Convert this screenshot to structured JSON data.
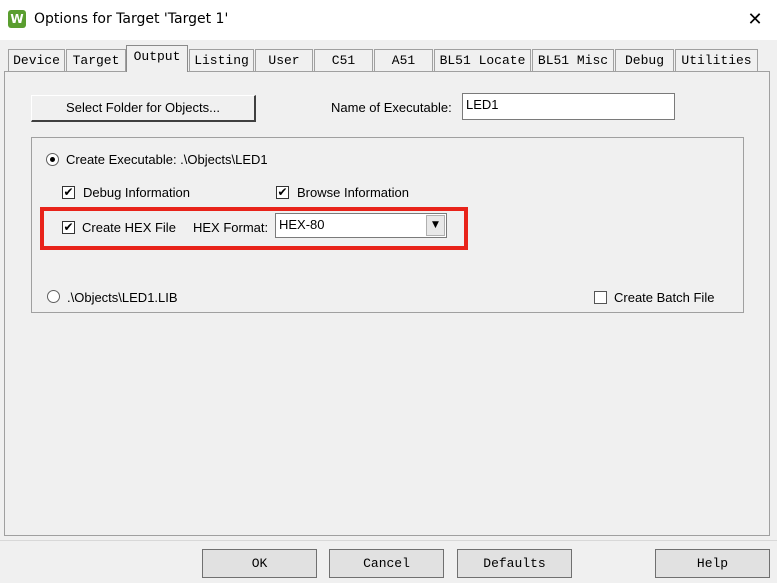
{
  "window": {
    "app_icon_glyph": "W",
    "title": "Options for Target 'Target 1'",
    "close_glyph": "✕"
  },
  "tabs": [
    {
      "label": "Device",
      "active": false
    },
    {
      "label": "Target",
      "active": false
    },
    {
      "label": "Output",
      "active": true
    },
    {
      "label": "Listing",
      "active": false
    },
    {
      "label": "User",
      "active": false
    },
    {
      "label": "C51",
      "active": false
    },
    {
      "label": "A51",
      "active": false
    },
    {
      "label": "BL51 Locate",
      "active": false
    },
    {
      "label": "BL51 Misc",
      "active": false
    },
    {
      "label": "Debug",
      "active": false
    },
    {
      "label": "Utilities",
      "active": false
    }
  ],
  "output": {
    "select_folder_label": "Select Folder for Objects...",
    "name_label": "Name of Executable:",
    "name_value": "LED1",
    "create_executable": {
      "label": "Create Executable:  .\\Objects\\LED1",
      "selected": true
    },
    "debug_info": {
      "label": "Debug Information",
      "checked": true
    },
    "browse_info": {
      "label": "Browse Information",
      "checked": true
    },
    "create_hex": {
      "label": "Create HEX File",
      "checked": true
    },
    "hex_format_label": "HEX Format:",
    "hex_format_value": "HEX-80",
    "create_library": {
      "label": ".\\Objects\\LED1.LIB",
      "selected": false
    },
    "create_batch": {
      "label": "Create Batch File",
      "checked": false
    },
    "highlight_color": "#e8231a"
  },
  "buttons": {
    "ok": "OK",
    "cancel": "Cancel",
    "defaults": "Defaults",
    "help": "Help"
  },
  "icons": {
    "check_glyph": "✔",
    "dropdown_glyph": "▼"
  }
}
